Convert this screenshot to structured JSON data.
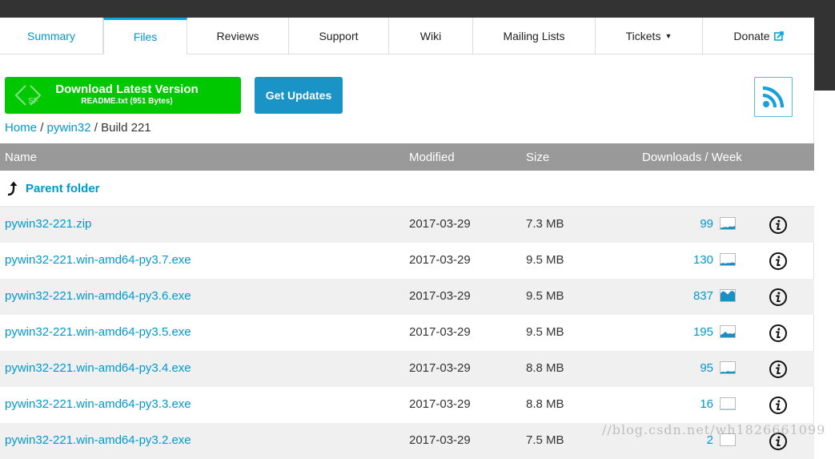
{
  "tabs": [
    {
      "label": "Summary"
    },
    {
      "label": "Files"
    },
    {
      "label": "Reviews"
    },
    {
      "label": "Support"
    },
    {
      "label": "Wiki"
    },
    {
      "label": "Mailing Lists"
    },
    {
      "label": "Tickets"
    },
    {
      "label": "Donate"
    }
  ],
  "download": {
    "title": "Download Latest Version",
    "subtitle": "README.txt (951 Bytes)"
  },
  "updates": {
    "label": "Get Updates"
  },
  "breadcrumb": {
    "home": "Home",
    "sep": "/",
    "project": "pywin32",
    "current": "Build 221"
  },
  "table": {
    "headers": {
      "name": "Name",
      "modified": "Modified",
      "size": "Size",
      "downloads": "Downloads / Week"
    },
    "parent_label": "Parent folder",
    "rows": [
      {
        "name": "pywin32-221.zip",
        "modified": "2017-03-29",
        "size": "7.3 MB",
        "downloads": "99",
        "trend": [
          0.1,
          0.15,
          0.2,
          0.15,
          0.25,
          0.2,
          0.3
        ]
      },
      {
        "name": "pywin32-221.win-amd64-py3.7.exe",
        "modified": "2017-03-29",
        "size": "9.5 MB",
        "downloads": "130",
        "trend": [
          0.15,
          0.2,
          0.15,
          0.2,
          0.2,
          0.25,
          0.2
        ]
      },
      {
        "name": "pywin32-221.win-amd64-py3.6.exe",
        "modified": "2017-03-29",
        "size": "9.5 MB",
        "downloads": "837",
        "trend": [
          0.7,
          0.9,
          0.8,
          0.6,
          0.85,
          0.95,
          0.75
        ]
      },
      {
        "name": "pywin32-221.win-amd64-py3.5.exe",
        "modified": "2017-03-29",
        "size": "9.5 MB",
        "downloads": "195",
        "trend": [
          0.2,
          0.3,
          0.5,
          0.3,
          0.35,
          0.3,
          0.4
        ]
      },
      {
        "name": "pywin32-221.win-amd64-py3.4.exe",
        "modified": "2017-03-29",
        "size": "8.8 MB",
        "downloads": "95",
        "trend": [
          0.1,
          0.15,
          0.1,
          0.2,
          0.15,
          0.15,
          0.2
        ]
      },
      {
        "name": "pywin32-221.win-amd64-py3.3.exe",
        "modified": "2017-03-29",
        "size": "8.8 MB",
        "downloads": "16",
        "trend": [
          0.02,
          0.03,
          0.02,
          0.03,
          0.02,
          0.03,
          0.02
        ]
      },
      {
        "name": "pywin32-221.win-amd64-py3.2.exe",
        "modified": "2017-03-29",
        "size": "7.5 MB",
        "downloads": "2",
        "trend": [
          0.0,
          0.01,
          0.0,
          0.01,
          0.0,
          0.0,
          0.01
        ]
      }
    ]
  },
  "watermark": "//blog.csdn.net/wh1826661099",
  "colors": {
    "accent": "#0098d0",
    "download_green": "#00c800",
    "updates_blue": "#1a93c6",
    "header_gray": "#999999",
    "topbar": "#333333"
  }
}
